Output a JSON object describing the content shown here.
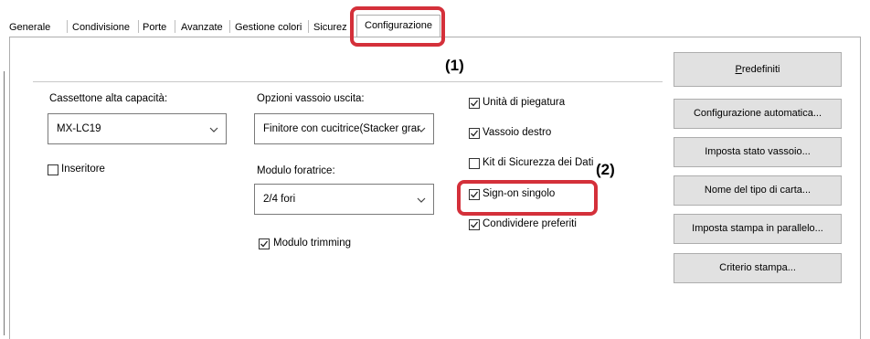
{
  "tabs": [
    "Generale",
    "Condivisione",
    "Porte",
    "Avanzate",
    "Gestione colori",
    "Sicurez"
  ],
  "active_tab": "Configurazione",
  "callouts": {
    "one": "(1)",
    "two": "(2)"
  },
  "left_column": {
    "cassettone_label": "Cassettone alta capacità:",
    "cassettone_value": "MX-LC19",
    "inseritore_label": "Inseritore",
    "inseritore_checked": false
  },
  "middle_column": {
    "opzioni_label": "Opzioni vassoio uscita:",
    "opzioni_value": "Finitore con cucitrice(Stacker gran",
    "foratrice_label": "Modulo foratrice:",
    "foratrice_value": "2/4 fori",
    "trimming_label": "Modulo trimming",
    "trimming_checked": true
  },
  "right_checks": [
    {
      "label": "Unità di piegatura",
      "checked": true
    },
    {
      "label": "Vassoio destro",
      "checked": true
    },
    {
      "label": "Kit di Sicurezza dei Dati",
      "checked": false
    },
    {
      "label": "Sign-on singolo",
      "checked": true
    },
    {
      "label": "Condividere preferiti",
      "checked": true
    }
  ],
  "buttons": {
    "predefiniti": "Predefiniti",
    "config_auto": "Configurazione automatica...",
    "stato_vassoio": "Imposta stato vassoio...",
    "nome_tipo_carta": "Nome del tipo di carta...",
    "stampa_parallelo": "Imposta stampa in parallelo...",
    "criterio_stampa": "Criterio stampa..."
  },
  "colors": {
    "highlight": "#d4303a",
    "button_bg": "#e1e1e1"
  }
}
